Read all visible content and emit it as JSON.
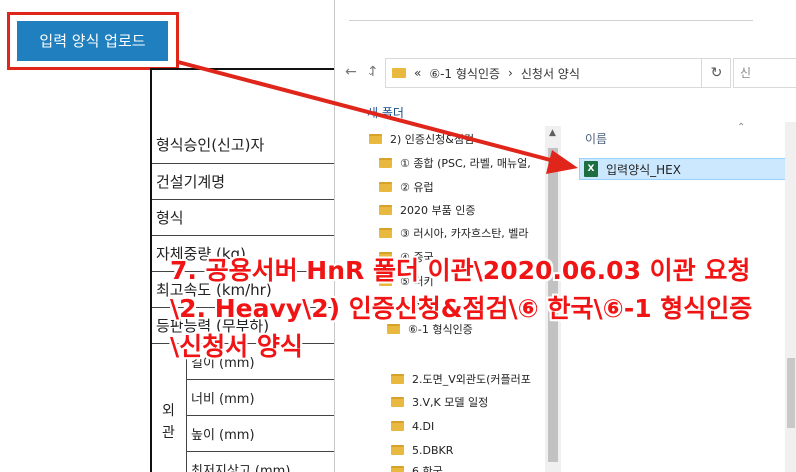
{
  "upload_button": {
    "label": "입력 양식 업로드"
  },
  "form": {
    "rows": [
      "형식승인(신고)자",
      "건설기계명",
      "형식",
      "자체중량 (kg)",
      "최고속도 (km/hr)",
      "등판능력 (무부하)"
    ],
    "group_label": [
      "외",
      "관"
    ],
    "sub_rows": [
      "길이 (mm)",
      "너비 (mm)",
      "높이 (mm)",
      "최저지상고 (mm)"
    ]
  },
  "explorer": {
    "address": {
      "prefix": "«",
      "segments": [
        "⑥-1 형식인증",
        "신청서 양식"
      ],
      "separator": "›"
    },
    "search_placeholder": "신",
    "new_folder": "새 폴더",
    "nav": {
      "back": "←",
      "forward": "→",
      "up": "↑",
      "dropdown": "⌄",
      "refresh": "↻"
    },
    "tree": [
      "2) 인증신청&점검",
      "① 종합 (PSC, 라벨, 매뉴얼,",
      "② 유럽",
      "2020 부품 인증",
      "③ 러시아, 카자흐스탄, 벨라",
      "④ 중국",
      "⑤ 터키",
      "⑥ 한국",
      "⑥-1 형식인증",
      "2.도면_V외관도(커플러포",
      "3.V,K 모델 일정",
      "4.DI",
      "5.DBKR",
      "6.한국"
    ],
    "column_header": "이름",
    "file": {
      "name": "입력양식_HEX",
      "icon": "excel-file-icon"
    }
  },
  "caption": "7. 공용서버 HnR 폴더 이관\\2020.06.03 이관 요청\\2. Heavy\\2) 인증신청&점검\\⑥ 한국\\⑥-1 형식인증\\신청서 양식",
  "colors": {
    "annotation": "#f01414",
    "button": "#1f7fbf",
    "selection": "#cce8ff",
    "folder": "#e8b93e"
  }
}
